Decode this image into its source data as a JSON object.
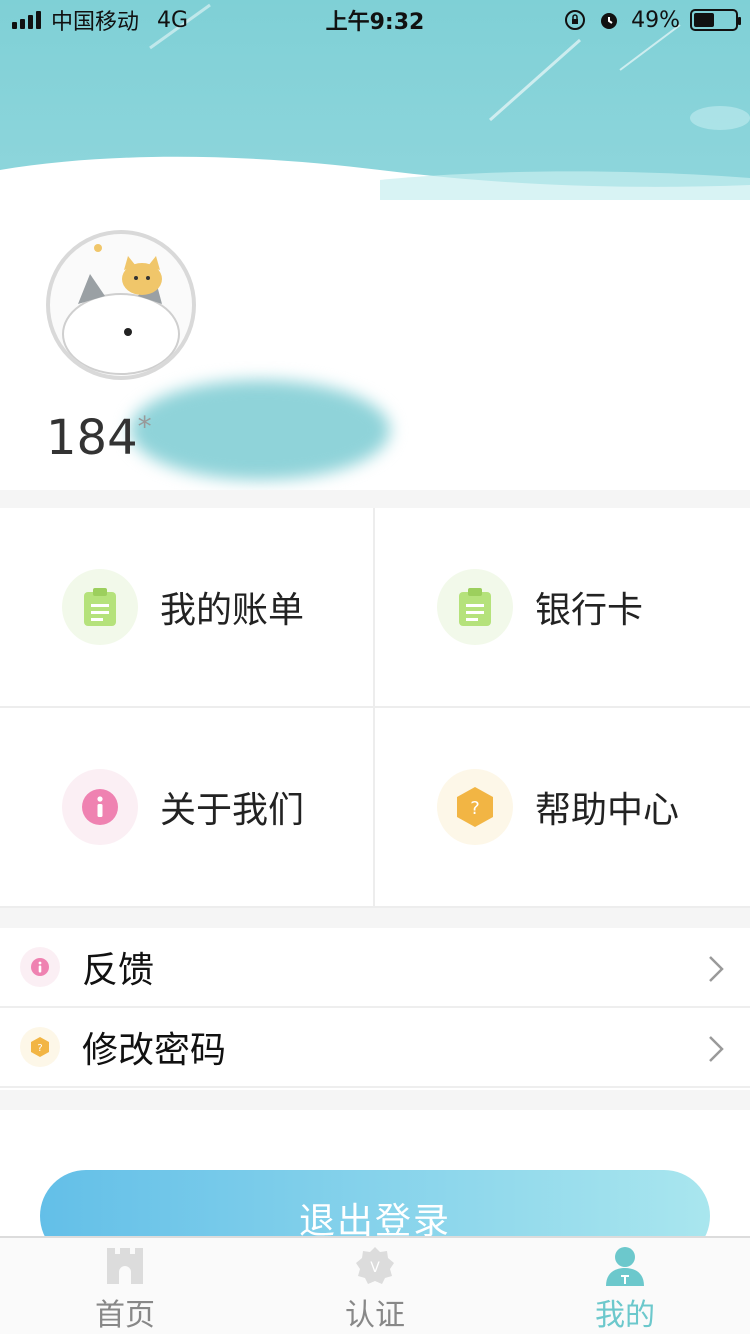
{
  "status_bar": {
    "carrier": "中国移动",
    "network": "4G",
    "time": "上午9:32",
    "battery_percent": "49%",
    "battery_level": 0.49
  },
  "profile": {
    "phone_visible": "184",
    "asterisk": "*"
  },
  "grid": [
    {
      "label": "我的账单",
      "icon": "clipboard-icon",
      "color": "#b5e27b"
    },
    {
      "label": "银行卡",
      "icon": "clipboard-icon",
      "color": "#b5e27b"
    },
    {
      "label": "关于我们",
      "icon": "info-icon",
      "color": "#ef82b1"
    },
    {
      "label": "帮助中心",
      "icon": "help-hexagon-icon",
      "color": "#f2b544"
    }
  ],
  "list": [
    {
      "label": "反馈",
      "icon": "info-icon",
      "color": "#ef82b1"
    },
    {
      "label": "修改密码",
      "icon": "help-hexagon-icon",
      "color": "#f2b544"
    }
  ],
  "logout_label": "退出登录",
  "tabs": [
    {
      "label": "首页",
      "icon": "home-castle-icon",
      "active": false
    },
    {
      "label": "认证",
      "icon": "verify-badge-icon",
      "active": false
    },
    {
      "label": "我的",
      "icon": "user-icon",
      "active": true
    }
  ],
  "colors": {
    "header": "#8fd6dc",
    "active_tab": "#6cc8cc",
    "logout_start": "#63bfe8",
    "logout_end": "#a9e6ee"
  }
}
